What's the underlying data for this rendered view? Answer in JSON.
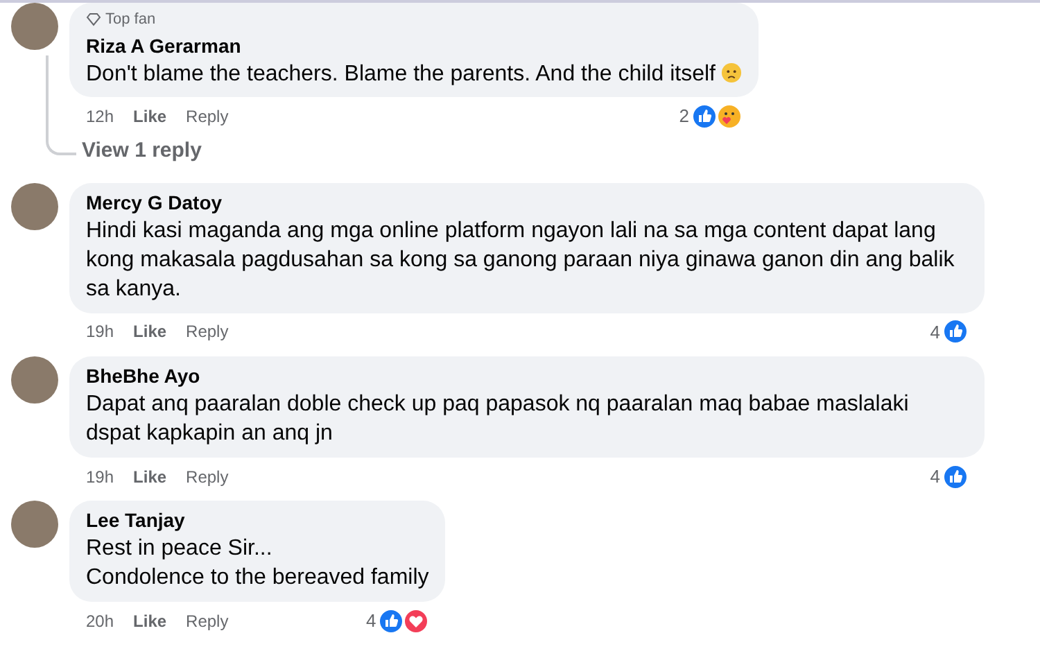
{
  "comments": [
    {
      "badge": "Top fan",
      "name": "Riza A Gerarman",
      "text": "Don't blame the teachers. Blame the parents. And the child itself",
      "emoji": {
        "kind": "sad"
      },
      "time": "12h",
      "like": "Like",
      "reply": "Reply",
      "reaction_count": "2",
      "reactions": [
        {
          "kind": "like"
        },
        {
          "kind": "care"
        }
      ],
      "view_replies": "View 1 reply"
    },
    {
      "name": "Mercy G Datoy",
      "text": "Hindi kasi maganda ang mga online platform ngayon lali na sa mga content dapat lang kong makasala pagdusahan sa kong sa ganong paraan niya ginawa ganon din ang balik sa kanya.",
      "time": "19h",
      "like": "Like",
      "reply": "Reply",
      "reaction_count": "4",
      "reactions": [
        {
          "kind": "like"
        }
      ]
    },
    {
      "name": "BheBhe Ayo",
      "text": "Dapat anq paaralan doble check up paq papasok nq paaralan maq babae maslalaki dspat kapkapin an anq jn",
      "time": "19h",
      "like": "Like",
      "reply": "Reply",
      "reaction_count": "4",
      "reactions": [
        {
          "kind": "like"
        }
      ]
    },
    {
      "name": "Lee Tanjay",
      "text": "Rest in peace Sir...\nCondolence to the bereaved family",
      "time": "20h",
      "like": "Like",
      "reply": "Reply",
      "reaction_count": "4",
      "reactions": [
        {
          "kind": "like"
        },
        {
          "kind": "love"
        }
      ]
    }
  ]
}
